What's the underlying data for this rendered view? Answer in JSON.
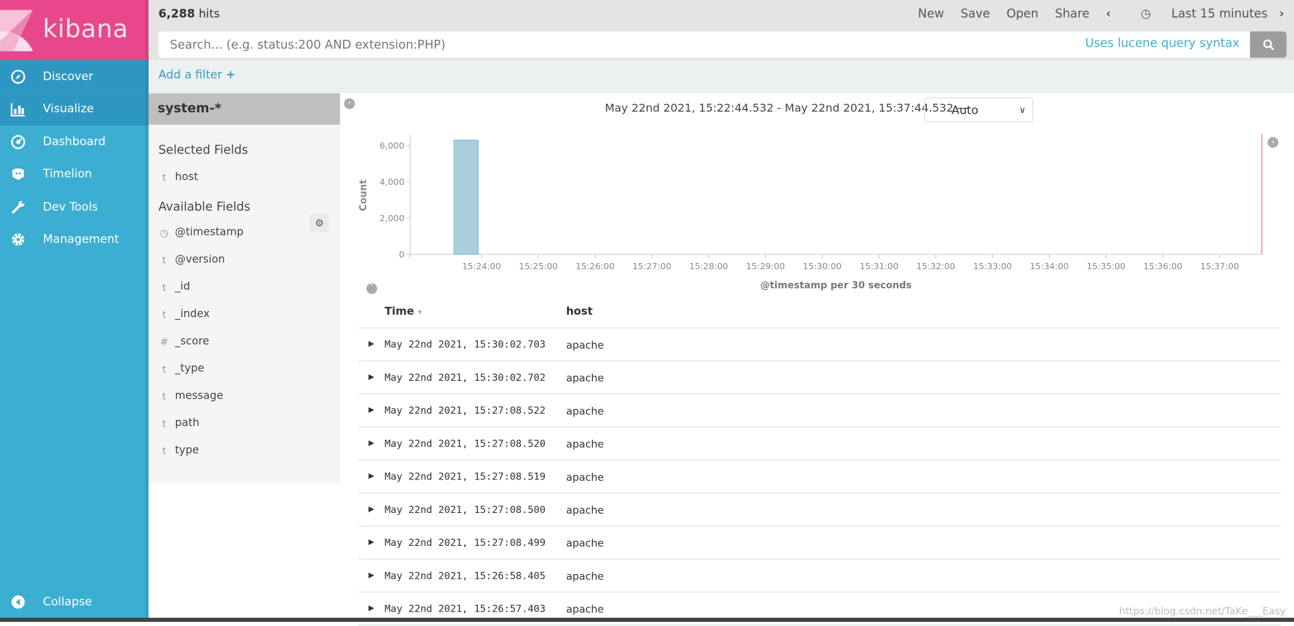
{
  "app": {
    "logo_text": "kibana",
    "brand_color": "#e8488b",
    "sidebar_color": "#3caed2"
  },
  "sidebar": {
    "items": [
      {
        "label": "Discover",
        "icon": "compass-icon",
        "active": true
      },
      {
        "label": "Visualize",
        "icon": "bar-chart-icon",
        "active": true
      },
      {
        "label": "Dashboard",
        "icon": "dashboard-icon"
      },
      {
        "label": "Timelion",
        "icon": "timelion-icon"
      },
      {
        "label": "Dev Tools",
        "icon": "wrench-icon"
      },
      {
        "label": "Management",
        "icon": "gear-icon"
      }
    ],
    "collapse": "Collapse"
  },
  "topbar": {
    "hits_count": "6,288",
    "hits_label": "hits",
    "menu": [
      "New",
      "Save",
      "Open",
      "Share"
    ],
    "time_picker": "Last 15 minutes"
  },
  "search": {
    "placeholder": "Search... (e.g. status:200 AND extension:PHP)",
    "value": "",
    "syntax_link": "Uses lucene query syntax"
  },
  "filter": {
    "add_label": "Add a filter"
  },
  "fields_panel": {
    "index_pattern": "system-*",
    "selected_title": "Selected Fields",
    "selected": [
      {
        "type": "t",
        "name": "host"
      }
    ],
    "available_title": "Available Fields",
    "available": [
      {
        "type": "clock",
        "name": "@timestamp"
      },
      {
        "type": "t",
        "name": "@version"
      },
      {
        "type": "t",
        "name": "_id"
      },
      {
        "type": "t",
        "name": "_index"
      },
      {
        "type": "#",
        "name": "_score"
      },
      {
        "type": "t",
        "name": "_type"
      },
      {
        "type": "t",
        "name": "message"
      },
      {
        "type": "t",
        "name": "path"
      },
      {
        "type": "t",
        "name": "type"
      }
    ]
  },
  "histogram": {
    "range_text": "May 22nd 2021, 15:22:44.532 - May 22nd 2021, 15:37:44.532 —",
    "interval": "Auto"
  },
  "chart_data": {
    "type": "bar",
    "ylabel": "Count",
    "xlabel": "@timestamp per 30 seconds",
    "x_range": [
      "15:22:44.532",
      "15:37:44.532"
    ],
    "ylim": [
      0,
      6500
    ],
    "yticks": [
      0,
      2000,
      4000,
      6000
    ],
    "ytick_labels": [
      "0",
      "2,000",
      "4,000",
      "6,000"
    ],
    "xtick_labels": [
      "15:24:00",
      "15:25:00",
      "15:26:00",
      "15:27:00",
      "15:28:00",
      "15:29:00",
      "15:30:00",
      "15:31:00",
      "15:32:00",
      "15:33:00",
      "15:34:00",
      "15:35:00",
      "15:36:00",
      "15:37:00"
    ],
    "bins": [
      {
        "x": "15:23:30",
        "value": 6288
      }
    ],
    "bar_color": "#a8cfdb",
    "grid": false
  },
  "table": {
    "columns": [
      "Time",
      "host"
    ],
    "rows": [
      {
        "time": "May 22nd 2021, 15:30:02.703",
        "host": "apache"
      },
      {
        "time": "May 22nd 2021, 15:30:02.702",
        "host": "apache"
      },
      {
        "time": "May 22nd 2021, 15:27:08.522",
        "host": "apache"
      },
      {
        "time": "May 22nd 2021, 15:27:08.520",
        "host": "apache"
      },
      {
        "time": "May 22nd 2021, 15:27:08.519",
        "host": "apache"
      },
      {
        "time": "May 22nd 2021, 15:27:08.500",
        "host": "apache"
      },
      {
        "time": "May 22nd 2021, 15:27:08.499",
        "host": "apache"
      },
      {
        "time": "May 22nd 2021, 15:26:58.405",
        "host": "apache"
      },
      {
        "time": "May 22nd 2021, 15:26:57.403",
        "host": "apache"
      }
    ]
  },
  "watermark": "https://blog.csdn.net/TaKe___Easy"
}
